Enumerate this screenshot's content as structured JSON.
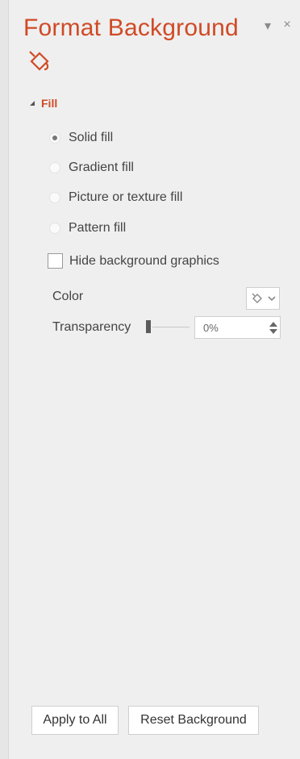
{
  "header": {
    "title": "Format Background",
    "controls": {
      "pin": "▾",
      "close": "×"
    },
    "tab_icon": "paint-bucket-icon"
  },
  "fill_section": {
    "label": "Fill",
    "options": [
      {
        "label": "Solid fill",
        "selected": true
      },
      {
        "label": "Gradient fill",
        "selected": false
      },
      {
        "label": "Picture or texture fill",
        "selected": false
      },
      {
        "label": "Pattern fill",
        "selected": false
      }
    ],
    "hide_graphics": {
      "label": "Hide background graphics",
      "checked": false
    },
    "color": {
      "label": "Color"
    },
    "transparency": {
      "label": "Transparency",
      "value": "0%"
    }
  },
  "buttons": {
    "apply_all": "Apply to All",
    "reset": "Reset Background"
  },
  "colors": {
    "accent": "#d04a26",
    "panel": "#efefef"
  }
}
